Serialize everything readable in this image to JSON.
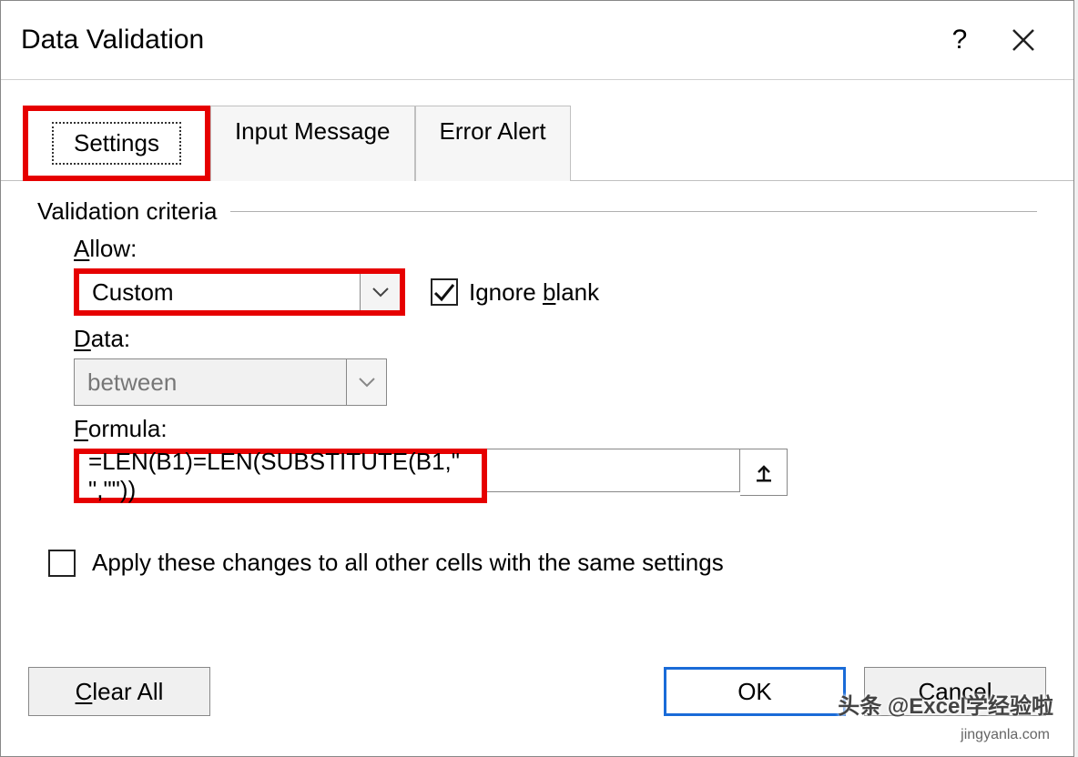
{
  "dialog": {
    "title": "Data Validation",
    "help_label": "?",
    "close_label": "✕"
  },
  "tabs": {
    "settings": "Settings",
    "input_message": "Input Message",
    "error_alert": "Error Alert"
  },
  "group_title": "Validation criteria",
  "allow": {
    "label": "Allow:",
    "value": "Custom"
  },
  "ignore_blank": {
    "label_pre": "Ignore ",
    "label_u": "b",
    "label_post": "lank",
    "checked": true
  },
  "data": {
    "label": "Data:",
    "value": "between"
  },
  "formula": {
    "label": "Formula:",
    "value": "=LEN(B1)=LEN(SUBSTITUTE(B1,\" \",\"\"))"
  },
  "apply": {
    "label_pre": "Apply these changes to all other cells with the same settings",
    "checked": false
  },
  "buttons": {
    "clear_all": "Clear All",
    "ok": "OK",
    "cancel": "Cancel"
  },
  "watermark": "头条 @Excel学经验啦",
  "watermark2": "jingyanla.com"
}
